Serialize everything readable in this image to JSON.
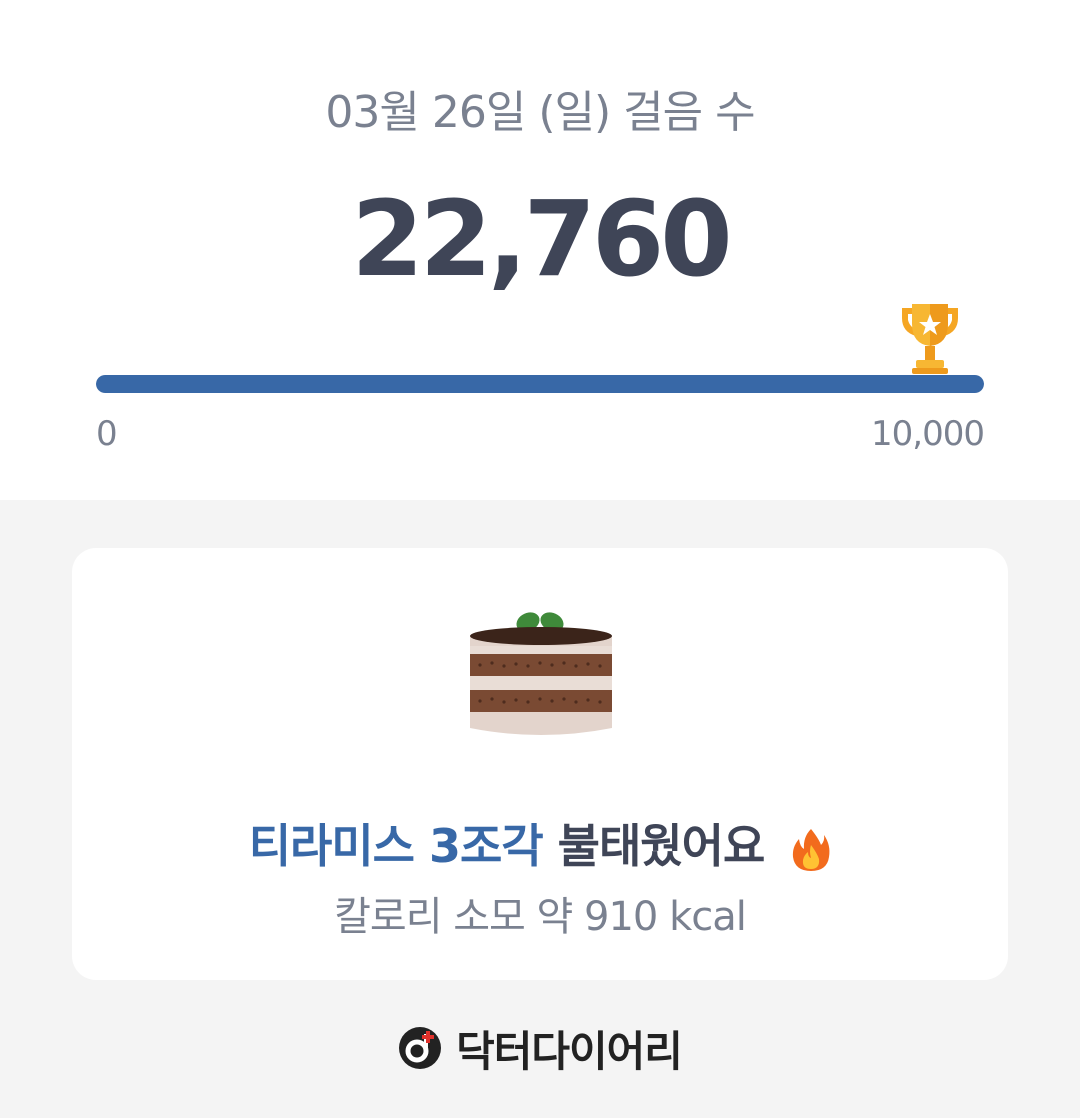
{
  "header": {
    "date_title": "03월 26일 (일) 걸음 수",
    "steps_display": "22,760"
  },
  "progress": {
    "min_label": "0",
    "max_label": "10,000",
    "fraction": 1.0,
    "color": "#3868a7"
  },
  "achievement": {
    "food_highlight": "티라미스 3조각",
    "burned_text": "불태웠어요",
    "calorie_text": "칼로리 소모 약 910 kcal",
    "highlight_color": "#3868a7"
  },
  "brand": {
    "name": "닥터다이어리"
  },
  "icons": {
    "trophy": "trophy-icon",
    "cake": "tiramisu-cake-icon",
    "fire": "fire-icon",
    "logo": "dr-diary-logo-icon"
  }
}
